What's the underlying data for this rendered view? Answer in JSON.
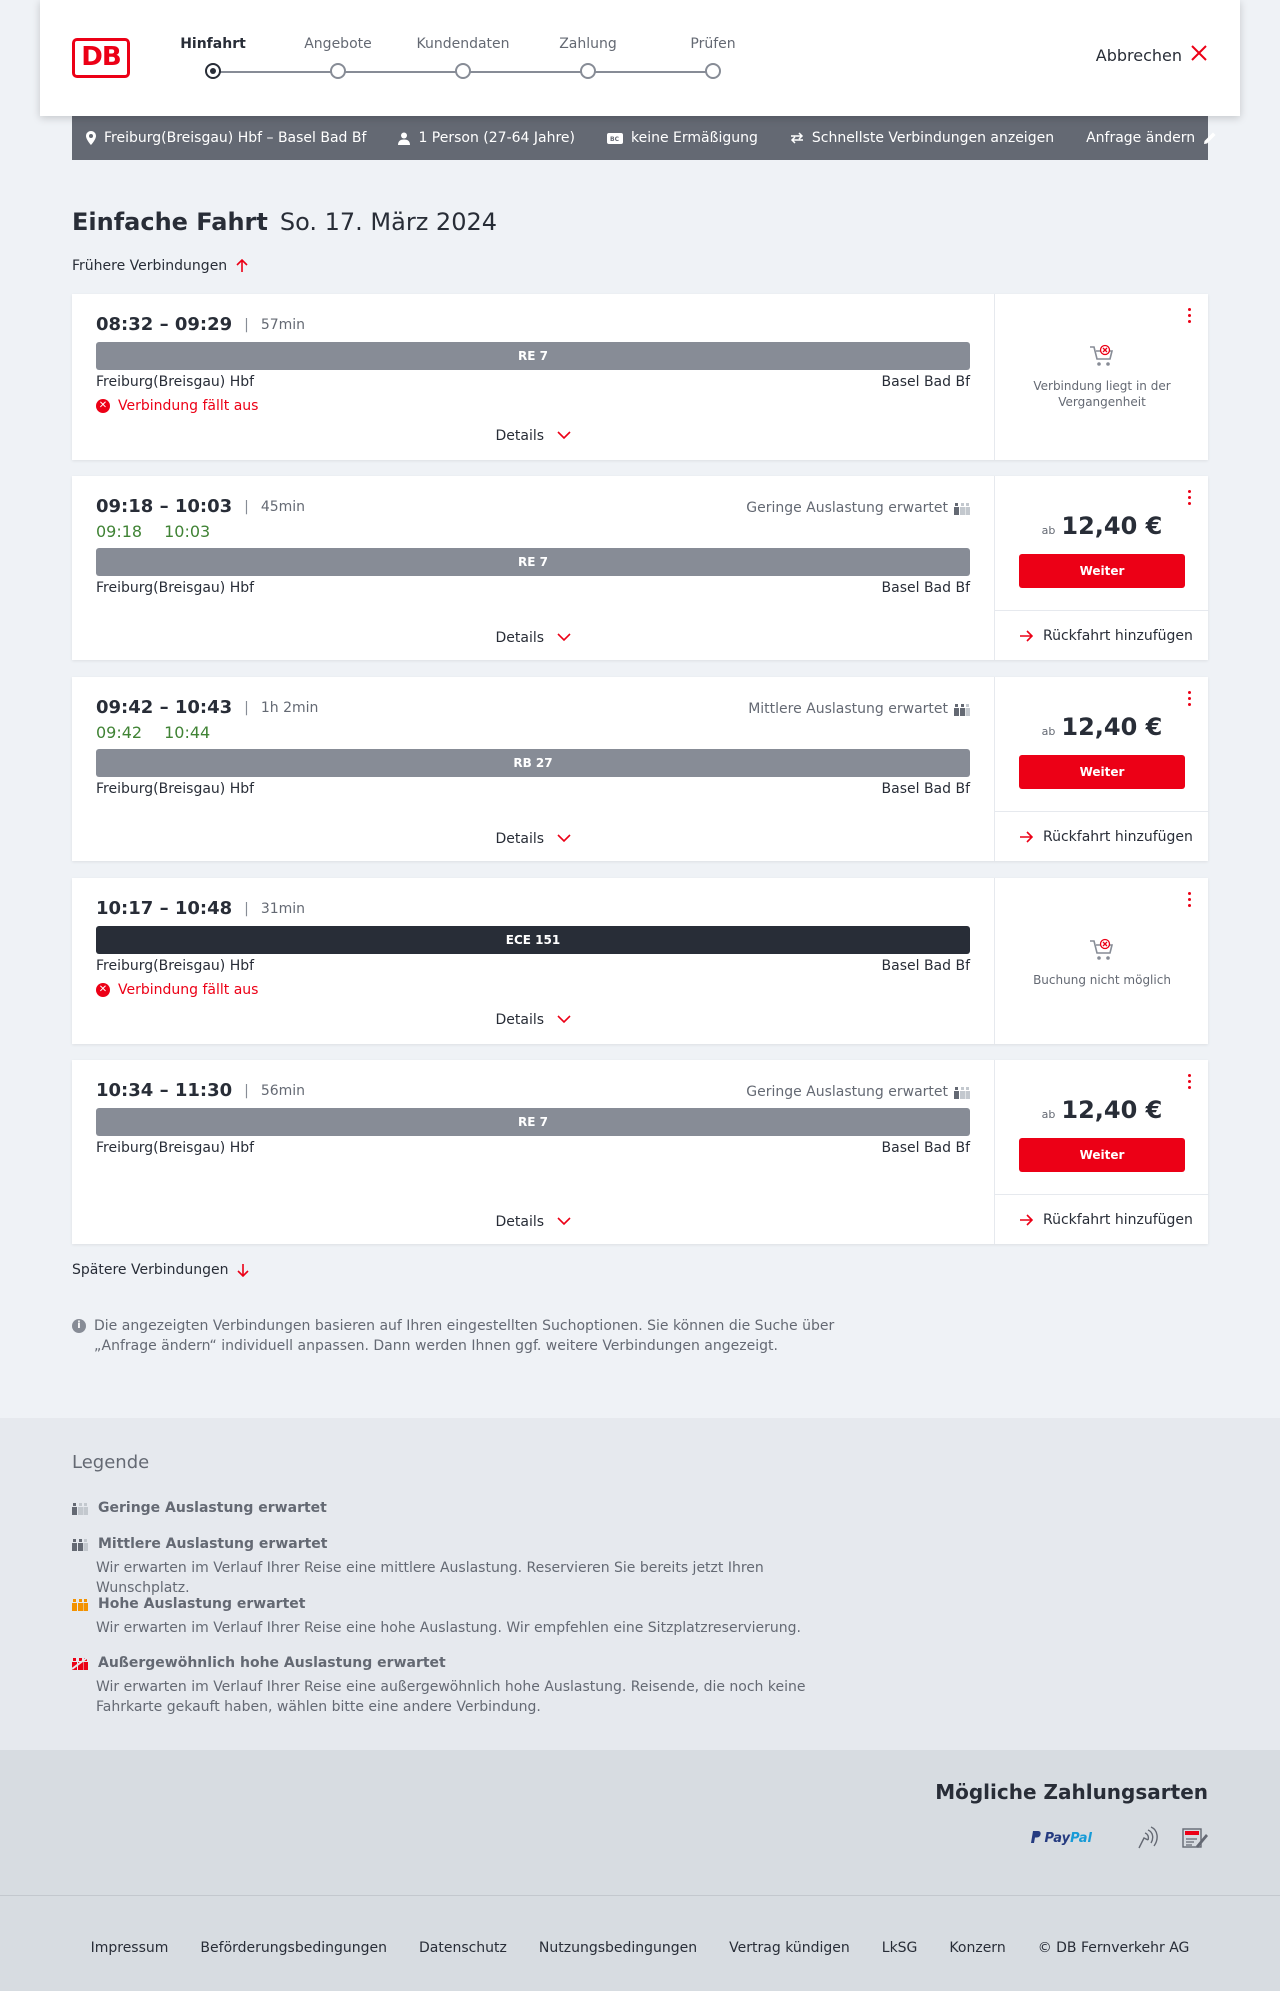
{
  "header": {
    "logo": "DB",
    "steps": [
      "Hinfahrt",
      "Angebote",
      "Kundendaten",
      "Zahlung",
      "Prüfen"
    ],
    "active_step": "Hinfahrt",
    "cancel_label": "Abbrechen"
  },
  "search": {
    "route": "Freiburg(Breisgau) Hbf – Basel Bad Bf",
    "travelers": "1 Person (27-64 Jahre)",
    "discount": "keine Ermäßigung",
    "fastest": "Schnellste Verbindungen anzeigen",
    "edit_label": "Anfrage ändern"
  },
  "page": {
    "trip_type": "Einfache Fahrt",
    "date": "So. 17. März 2024",
    "earlier_label": "Frühere Verbindungen",
    "later_label": "Spätere Verbindungen",
    "info_text": "Die angezeigten Verbindungen basieren auf Ihren eingestellten Suchoptionen. Sie können die Suche über „Anfrage ändern“ individuell anpassen. Dann werden Ihnen ggf. weitere Verbindungen angezeigt."
  },
  "connections": [
    {
      "times": "08:32 – 09:29",
      "duration": "57min",
      "train": "RE 7",
      "from": "Freiburg(Breisgau) Hbf",
      "to": "Basel Bad Bf",
      "status": "Verbindung fällt aus",
      "details": "Details",
      "unavailable": "Verbindung liegt in der Vergangenheit"
    },
    {
      "times": "09:18 – 10:03",
      "duration": "45min",
      "realtime_dep": "09:18",
      "realtime_arr": "10:03",
      "load": "Geringe Auslastung erwartet",
      "train": "RE 7",
      "from": "Freiburg(Breisgau) Hbf",
      "to": "Basel Bad Bf",
      "details": "Details",
      "price_prefix": "ab",
      "price": "12,40 €",
      "button": "Weiter",
      "return": "Rückfahrt hinzufügen"
    },
    {
      "times": "09:42 – 10:43",
      "duration": "1h 2min",
      "realtime_dep": "09:42",
      "realtime_arr": "10:44",
      "load": "Mittlere Auslastung erwartet",
      "train": "RB 27",
      "from": "Freiburg(Breisgau) Hbf",
      "to": "Basel Bad Bf",
      "details": "Details",
      "price_prefix": "ab",
      "price": "12,40 €",
      "button": "Weiter",
      "return": "Rückfahrt hinzufügen"
    },
    {
      "times": "10:17 – 10:48",
      "duration": "31min",
      "train": "ECE 151",
      "from": "Freiburg(Breisgau) Hbf",
      "to": "Basel Bad Bf",
      "status": "Verbindung fällt aus",
      "details": "Details",
      "unavailable": "Buchung nicht möglich"
    },
    {
      "times": "10:34 – 11:30",
      "duration": "56min",
      "load": "Geringe Auslastung erwartet",
      "train": "RE 7",
      "from": "Freiburg(Breisgau) Hbf",
      "to": "Basel Bad Bf",
      "details": "Details",
      "price_prefix": "ab",
      "price": "12,40 €",
      "button": "Weiter",
      "return": "Rückfahrt hinzufügen"
    }
  ],
  "legend": {
    "title": "Legende",
    "items": [
      {
        "label": "Geringe Auslastung erwartet",
        "desc": ""
      },
      {
        "label": "Mittlere Auslastung erwartet",
        "desc": "Wir erwarten im Verlauf Ihrer Reise eine mittlere Auslastung. Reservieren Sie bereits jetzt Ihren Wunschplatz."
      },
      {
        "label": "Hohe Auslastung erwartet",
        "desc": "Wir erwarten im Verlauf Ihrer Reise eine hohe Auslastung. Wir empfehlen eine Sitzplatzreservierung."
      },
      {
        "label": "Außergewöhnlich hohe Auslastung erwartet",
        "desc": "Wir erwarten im Verlauf Ihrer Reise eine außergewöhnlich hohe Auslastung. Reisende, die noch keine Fahrkarte gekauft haben, wählen bitte eine andere Verbindung."
      }
    ]
  },
  "payment": {
    "title": "Mögliche Zahlungsarten",
    "paypal_a": "Pay",
    "paypal_b": "Pal"
  },
  "footer": {
    "links": [
      "Impressum",
      "Beförderungsbedingungen",
      "Datenschutz",
      "Nutzungsbedingungen",
      "Vertrag kündigen",
      "LkSG",
      "Konzern",
      "© DB Fernverkehr AG"
    ]
  },
  "colors": {
    "primary": "#ec0016",
    "dark": "#282d37",
    "realtime_green": "#408335",
    "searchbar": "#646973",
    "train_bar": "#878c96",
    "load_high": "#f39200"
  }
}
